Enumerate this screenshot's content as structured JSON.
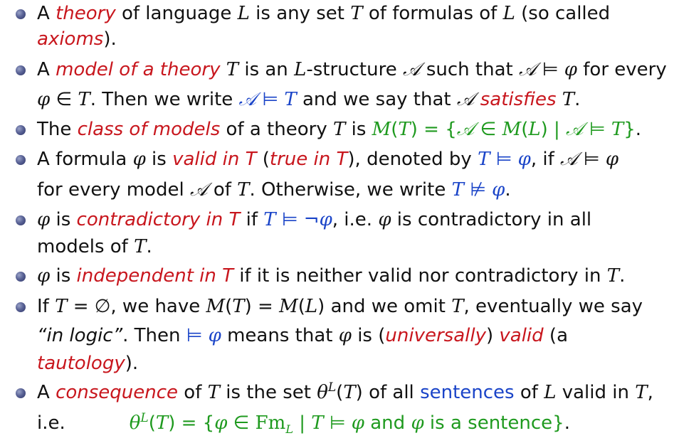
{
  "slide": {
    "items": [
      {
        "lines": [
          [
            "A ",
            {
              "c": "red",
              "t": "theory"
            },
            " of language ",
            {
              "m": "L"
            },
            " is any set ",
            {
              "m": "T"
            },
            " of formulas of ",
            {
              "m": "L"
            },
            " (so called"
          ],
          [
            {
              "c": "red",
              "t": "axioms"
            },
            ")."
          ]
        ]
      },
      {
        "lines": [
          [
            "A ",
            {
              "c": "red",
              "t": "model of a theory"
            },
            " ",
            {
              "m": "T"
            },
            " is an ",
            {
              "m": "L"
            },
            "-structure ",
            {
              "m": "𝒜"
            },
            " such that ",
            {
              "m": "𝒜"
            },
            " ⊨ ",
            {
              "m": "φ"
            },
            " for every"
          ],
          [
            {
              "m": "φ"
            },
            " ∈ ",
            {
              "m": "T"
            },
            ". Then we write ",
            {
              "c": "blue",
              "parts": [
                {
                  "m": "𝒜"
                },
                " ⊨ ",
                {
                  "m": "T"
                }
              ]
            },
            " and we say that ",
            {
              "m": "𝒜"
            },
            " ",
            {
              "c": "red",
              "t": "satisfies"
            },
            " ",
            {
              "m": "T"
            },
            "."
          ]
        ]
      },
      {
        "lines": [
          [
            "The ",
            {
              "c": "red",
              "t": "class of models"
            },
            " of a theory ",
            {
              "m": "T"
            },
            " is ",
            {
              "c": "green",
              "parts": [
                {
                  "m": "M"
                },
                "(",
                {
                  "m": "T"
                },
                ") = {",
                {
                  "m": "𝒜"
                },
                " ∈ ",
                {
                  "m": "M"
                },
                "(",
                {
                  "m": "L"
                },
                ") | ",
                {
                  "m": "𝒜"
                },
                " ⊨ ",
                {
                  "m": "T"
                },
                "}"
              ]
            },
            "."
          ]
        ]
      },
      {
        "lines": [
          [
            "A formula ",
            {
              "m": "φ"
            },
            " is ",
            {
              "c": "red",
              "t": "valid in T"
            },
            " (",
            {
              "c": "red",
              "t": "true in T"
            },
            "), denoted by ",
            {
              "c": "blue",
              "parts": [
                {
                  "m": "T"
                },
                " ⊨ ",
                {
                  "m": "φ"
                }
              ]
            },
            ", if ",
            {
              "m": "𝒜"
            },
            " ⊨ ",
            {
              "m": "φ"
            }
          ],
          [
            "for every model ",
            {
              "m": "𝒜"
            },
            " of ",
            {
              "m": "T"
            },
            ". Otherwise, we write ",
            {
              "c": "blue",
              "parts": [
                {
                  "m": "T"
                },
                " ⊭ ",
                {
                  "m": "φ"
                }
              ]
            },
            "."
          ]
        ]
      },
      {
        "lines": [
          [
            {
              "m": "φ"
            },
            " is ",
            {
              "c": "red",
              "t": "contradictory in T"
            },
            " if ",
            {
              "c": "blue",
              "parts": [
                {
                  "m": "T"
                },
                " ⊨ ¬",
                {
                  "m": "φ"
                }
              ]
            },
            ", i.e. ",
            {
              "m": "φ"
            },
            " is contradictory in all"
          ],
          [
            "models of ",
            {
              "m": "T"
            },
            "."
          ]
        ]
      },
      {
        "lines": [
          [
            {
              "m": "φ"
            },
            " is ",
            {
              "c": "red",
              "t": "independent in T"
            },
            " if it is neither valid nor contradictory in ",
            {
              "m": "T"
            },
            "."
          ]
        ]
      },
      {
        "lines": [
          [
            "If ",
            {
              "m": "T"
            },
            " = ∅, we have ",
            {
              "m": "M"
            },
            "(",
            {
              "m": "T"
            },
            ") = ",
            {
              "m": "M"
            },
            "(",
            {
              "m": "L"
            },
            ") and we omit ",
            {
              "m": "T"
            },
            ", eventually we say"
          ],
          [
            {
              "i": "“in logic”"
            },
            ". Then ",
            {
              "c": "blue",
              "parts": [
                " ⊨ ",
                {
                  "m": "φ"
                }
              ]
            },
            " means that ",
            {
              "m": "φ"
            },
            " is (",
            {
              "c": "red",
              "t": "universally"
            },
            ") ",
            {
              "c": "red",
              "t": "valid"
            },
            " (a"
          ],
          [
            {
              "c": "red",
              "t": "tautology"
            },
            ")."
          ]
        ]
      },
      {
        "lines": [
          [
            "A ",
            {
              "c": "red",
              "t": "consequence"
            },
            " of ",
            {
              "m": "T"
            },
            " is the set ",
            {
              "m": "θ"
            },
            {
              "sup": "L"
            },
            "(",
            {
              "m": "T"
            },
            ") of all ",
            {
              "c": "blue",
              "t": "sentences",
              "plain": true
            },
            " of ",
            {
              "m": "L"
            },
            " valid in ",
            {
              "m": "T"
            },
            ","
          ],
          [
            "i.e.",
            {
              "gap": 90
            },
            {
              "c": "green",
              "parts": [
                {
                  "m": "θ"
                },
                {
                  "sup": "L"
                },
                "(",
                {
                  "m": "T"
                },
                ") = {",
                {
                  "m": "φ"
                },
                " ∈ ",
                {
                  "mr": "Fm"
                },
                {
                  "sub": "L"
                },
                " | ",
                {
                  "m": "T"
                },
                " ⊨ ",
                {
                  "m": "φ"
                },
                " and ",
                {
                  "m": "φ"
                },
                " is a sentence}"
              ]
            },
            "."
          ]
        ]
      }
    ]
  }
}
